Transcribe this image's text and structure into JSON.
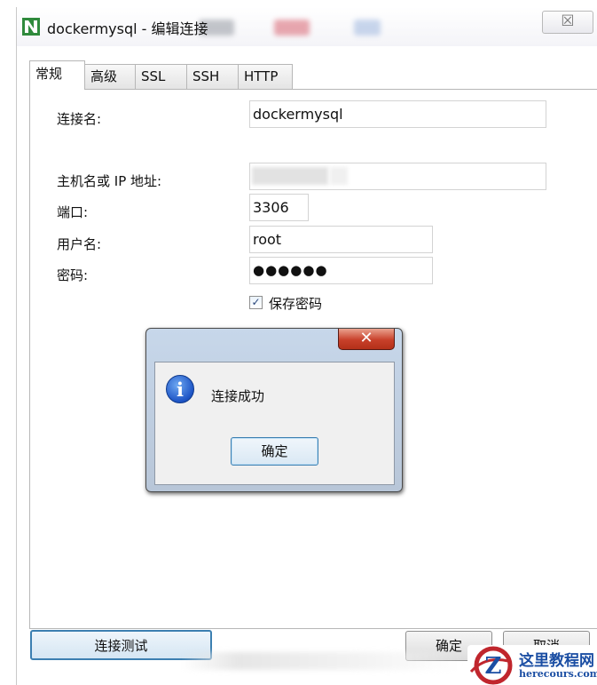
{
  "window": {
    "title": "dockermysql - 编辑连接",
    "close_glyph": "☒"
  },
  "tabs": [
    {
      "label": "常规",
      "active": true
    },
    {
      "label": "高级",
      "active": false
    },
    {
      "label": "SSL",
      "active": false
    },
    {
      "label": "SSH",
      "active": false
    },
    {
      "label": "HTTP",
      "active": false
    }
  ],
  "form": {
    "connection_name_label": "连接名:",
    "connection_name_value": "dockermysql",
    "host_label": "主机名或 IP 地址:",
    "host_value": "",
    "port_label": "端口:",
    "port_value": "3306",
    "username_label": "用户名:",
    "username_value": "root",
    "password_label": "密码:",
    "password_value": "●●●●●●",
    "save_password_label": "保存密码",
    "save_password_checked": "✓"
  },
  "dialog": {
    "close_glyph": "✕",
    "info_glyph": "i",
    "message": "连接成功",
    "ok_label": "确定"
  },
  "buttons": {
    "test_connection": "连接测试",
    "ok": "确定",
    "cancel": "取消"
  },
  "watermark": {
    "title": "这里教程网",
    "url": "herecours.com"
  },
  "colors": {
    "accent": "#3c7fb1",
    "dialog_frame": "#b8c6d8",
    "close_red": "#c8402a",
    "info_blue": "#1d54c5",
    "app_icon_green": "#2f8a3c"
  }
}
